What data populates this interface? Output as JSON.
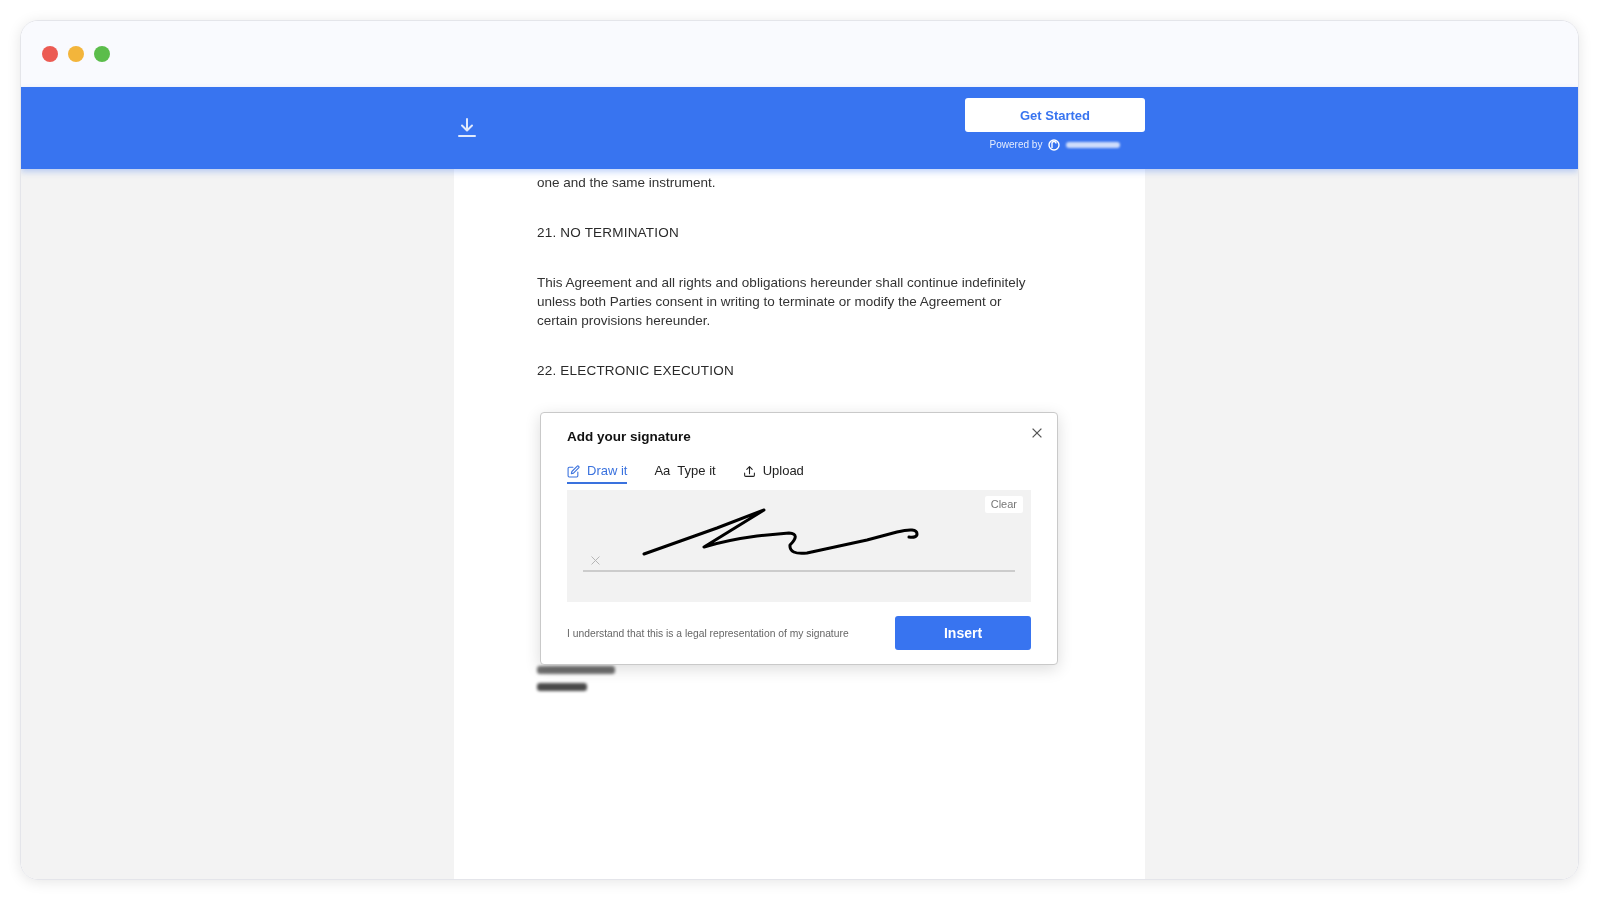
{
  "window": {
    "controls": [
      {
        "color": "#ec5b53"
      },
      {
        "color": "#f3b53b"
      },
      {
        "color": "#5bbd4b"
      }
    ]
  },
  "header": {
    "button": "Get Started",
    "powered_by": "Powered by"
  },
  "document": {
    "blocks": [
      {
        "kind": "text",
        "text": "one and the same instrument."
      },
      {
        "kind": "heading",
        "text": "21. NO TERMINATION"
      },
      {
        "kind": "text",
        "text": "This Agreement and all rights and obligations hereunder shall continue indefinitely unless both Parties consent in writing to terminate or modify the Agreement or certain provisions hereunder."
      },
      {
        "kind": "heading",
        "text": "22. ELECTRONIC EXECUTION"
      }
    ]
  },
  "signature_dialog": {
    "title": "Add your signature",
    "tabs": [
      {
        "kind": "draw",
        "label": "Draw it",
        "selected": true
      },
      {
        "kind": "type",
        "glyph": "Aa",
        "label": "Type it",
        "selected": false
      },
      {
        "kind": "upload",
        "label": "Upload",
        "selected": false
      }
    ],
    "pad": {
      "clear_button": "Clear"
    },
    "disclaimer": "I understand that this is a legal representation of my signature",
    "insert_button": "Insert"
  }
}
